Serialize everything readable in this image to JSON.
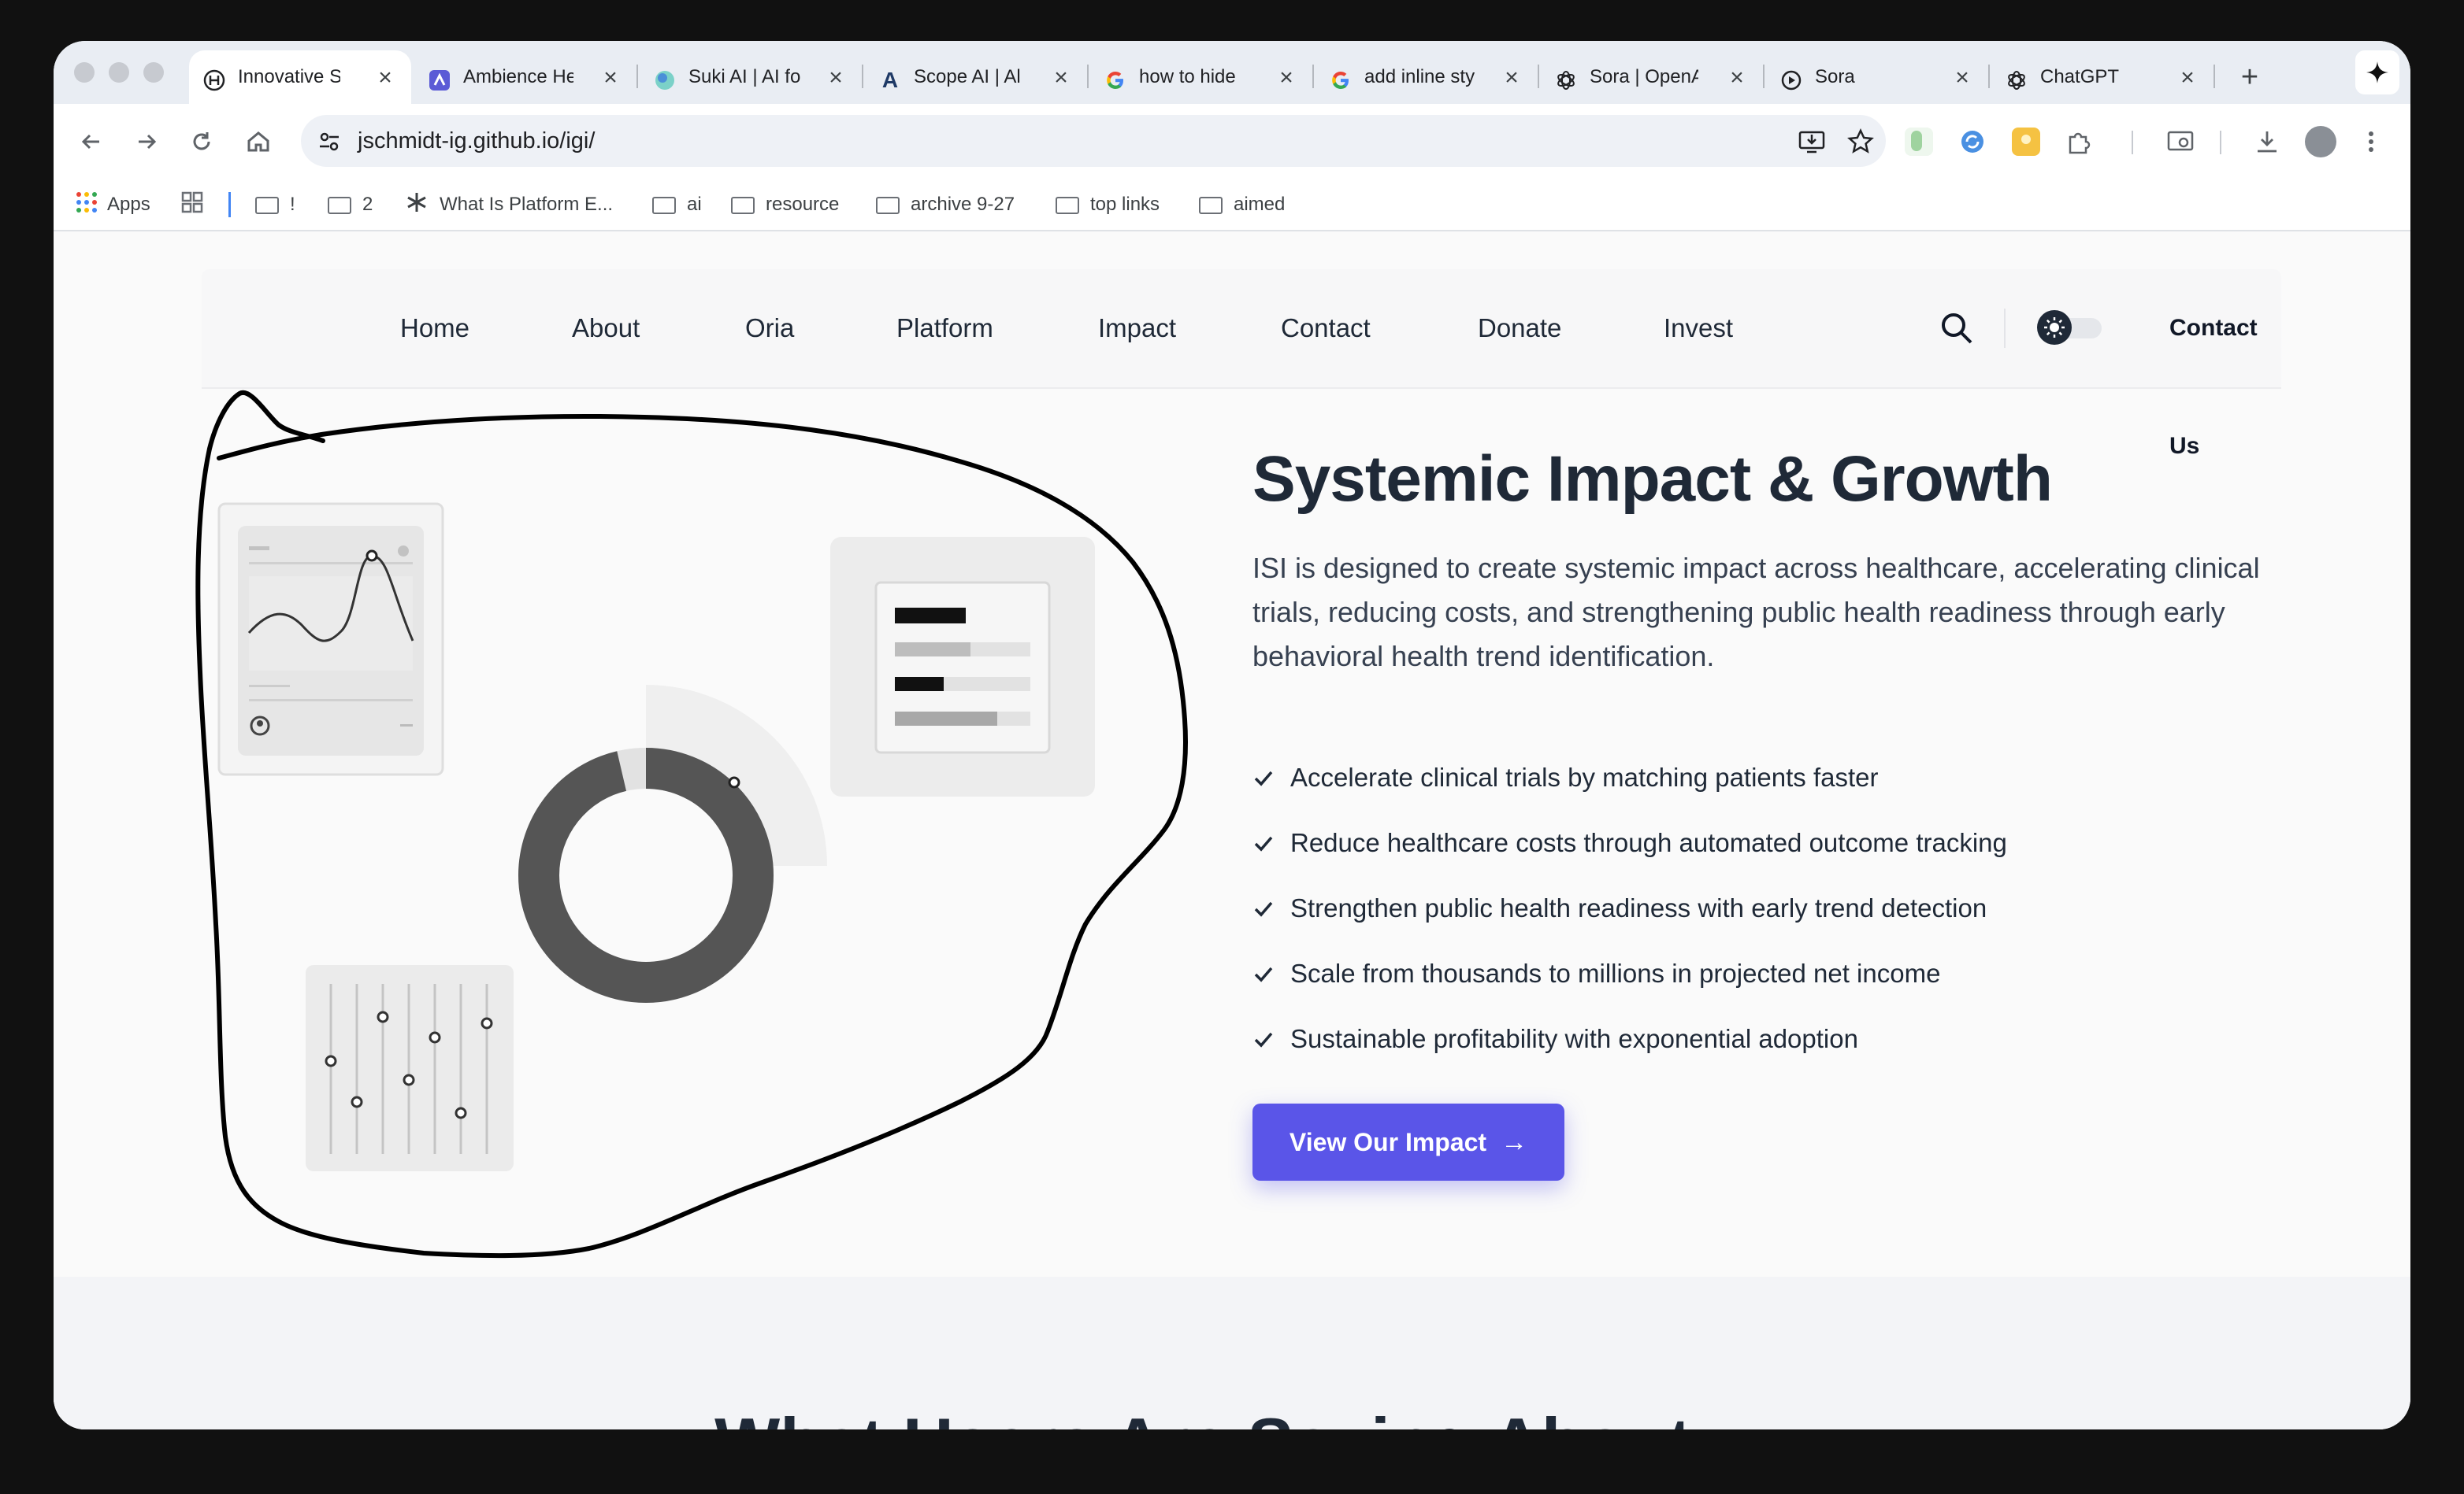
{
  "browser": {
    "tabs": [
      {
        "title": "Innovative Sy",
        "icon": "hyperlink-h-icon",
        "active": true
      },
      {
        "title": "Ambience He",
        "icon": "ambience-logo-icon",
        "active": false
      },
      {
        "title": "Suki AI | AI fo",
        "icon": "suki-logo-icon",
        "active": false
      },
      {
        "title": "Scope AI | Al",
        "icon": "scope-a-logo-icon",
        "active": false
      },
      {
        "title": "how to hide",
        "icon": "google-g-icon",
        "active": false
      },
      {
        "title": "add inline sty",
        "icon": "google-g-icon",
        "active": false
      },
      {
        "title": "Sora | OpenA",
        "icon": "openai-logo-icon",
        "active": false
      },
      {
        "title": "Sora",
        "icon": "play-circle-icon",
        "active": false
      },
      {
        "title": "ChatGPT",
        "icon": "openai-logo-icon",
        "active": false
      }
    ],
    "new_tab_symbol": "+",
    "url": "jschmidt-ig.github.io/igi/",
    "bookmarks": [
      {
        "label": "Apps",
        "icon": "apps-grid-icon"
      },
      {
        "label": "",
        "icon": "tab-groups-icon"
      },
      {
        "label": "!",
        "icon": "folder-icon"
      },
      {
        "label": "2",
        "icon": "folder-icon"
      },
      {
        "label": "What Is Platform E...",
        "icon": "snowflake-icon"
      },
      {
        "label": "ai",
        "icon": "folder-icon"
      },
      {
        "label": "resource",
        "icon": "folder-icon"
      },
      {
        "label": "archive 9-27",
        "icon": "folder-icon"
      },
      {
        "label": "top links",
        "icon": "folder-icon"
      },
      {
        "label": "aimed",
        "icon": "folder-icon"
      }
    ]
  },
  "site": {
    "nav": {
      "links": [
        "Home",
        "About",
        "Oria",
        "Platform",
        "Impact",
        "Contact",
        "Donate",
        "Invest"
      ],
      "contact_us": "Contact Us"
    },
    "hero": {
      "title": "Systemic Impact & Growth",
      "description": "ISI is designed to create systemic impact across healthcare, accelerating clinical trials, reducing costs, and strengthening public health readiness through early behavioral health trend identification.",
      "benefits": [
        "Accelerate clinical trials by matching patients faster",
        "Reduce healthcare costs through automated outcome tracking",
        "Strengthen public health readiness with early trend detection",
        "Scale from thousands to millions in projected net income",
        "Sustainable profitability with exponential adoption"
      ],
      "cta_label": "View Our Impact",
      "cta_arrow": "→"
    },
    "next_section_title": "What Users Are Saying About..."
  },
  "colors": {
    "accent": "#5a55e8",
    "text_dark": "#1f2937",
    "annotation_ink": "#000000"
  }
}
